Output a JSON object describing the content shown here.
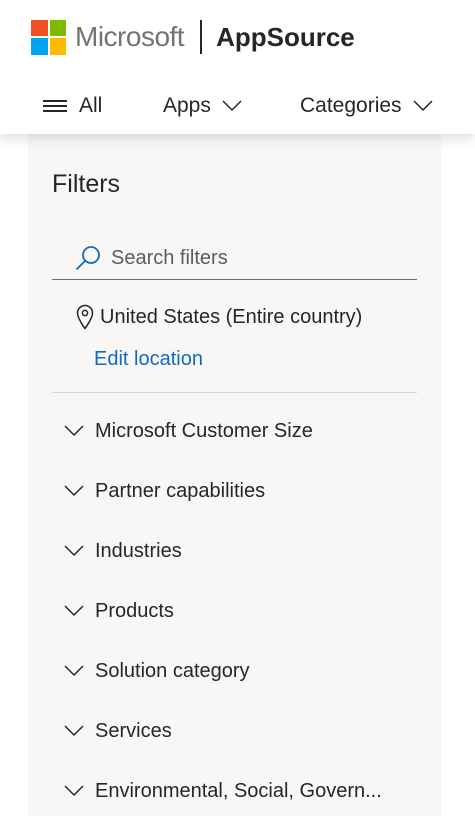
{
  "header": {
    "brand": "Microsoft",
    "product": "AppSource",
    "logo_colors": [
      "#f25022",
      "#7fba00",
      "#00a4ef",
      "#ffb900"
    ],
    "nav": [
      {
        "label": "All",
        "icon": "hamburger-icon"
      },
      {
        "label": "Apps",
        "icon": "chevron-down-icon"
      },
      {
        "label": "Categories",
        "icon": "chevron-down-icon"
      }
    ]
  },
  "filters": {
    "title": "Filters",
    "search_placeholder": "Search filters",
    "location": "United States (Entire country)",
    "edit_location": "Edit location",
    "link_color": "#0f6cbd",
    "items": [
      "Microsoft Customer Size",
      "Partner capabilities",
      "Industries",
      "Products",
      "Solution category",
      "Services",
      "Environmental, Social, Govern..."
    ]
  }
}
